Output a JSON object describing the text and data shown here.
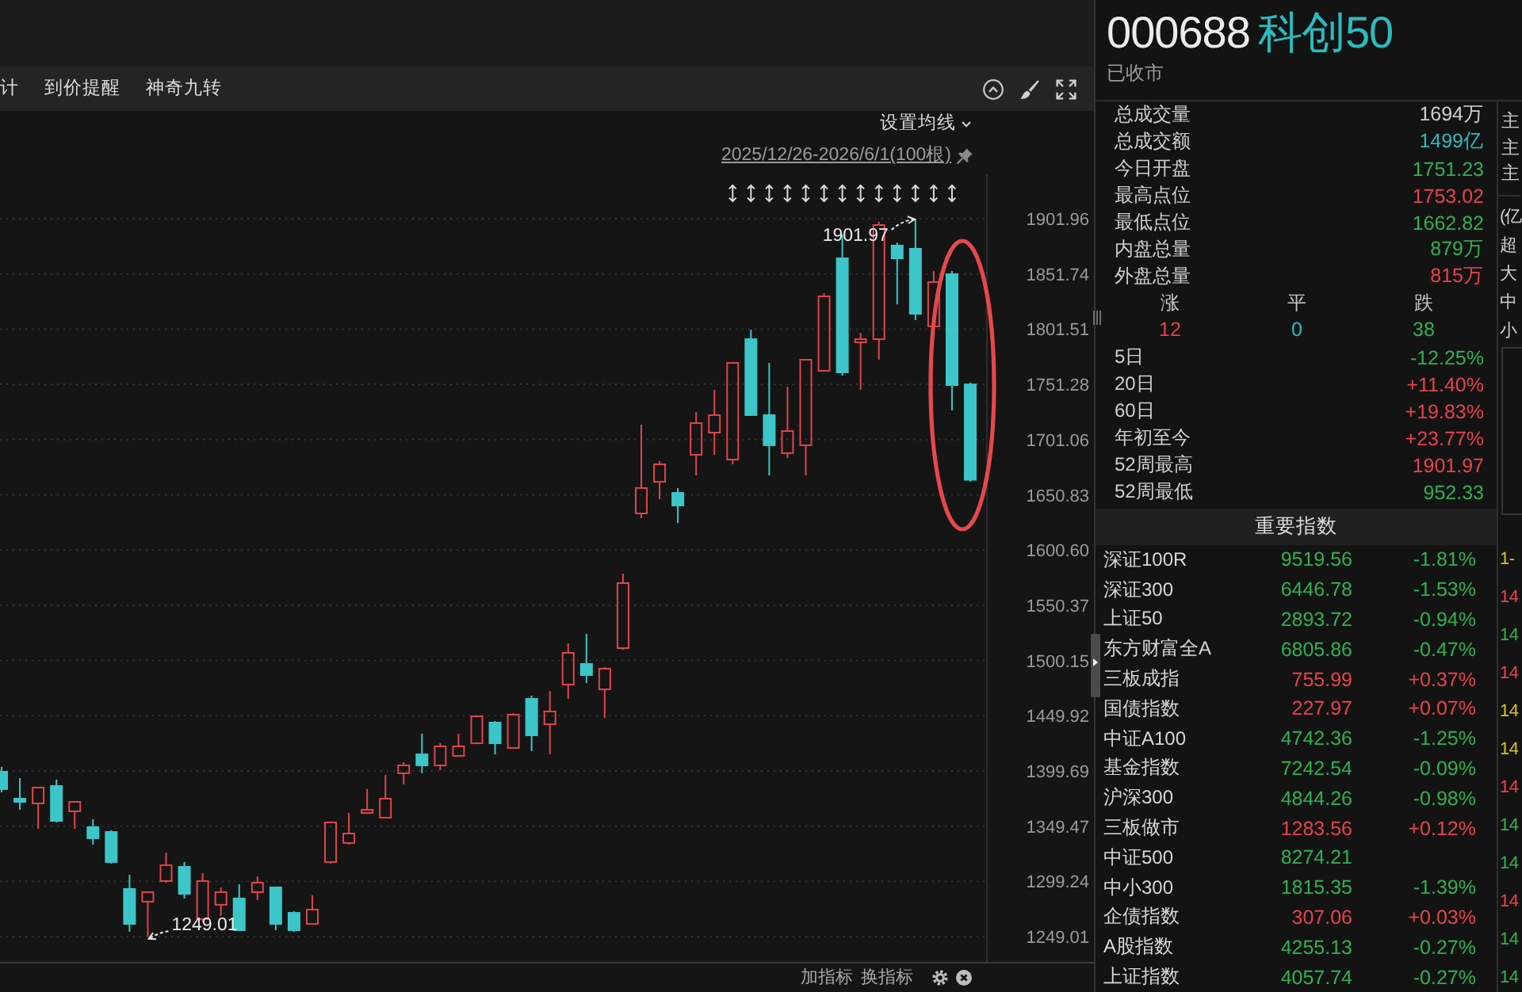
{
  "toolbar": {
    "items": [
      {
        "label": "计"
      },
      {
        "label": "到价提醒"
      },
      {
        "label": "神奇九转"
      }
    ]
  },
  "chart": {
    "ma_setting": "设置均线",
    "range": "2025/12/26-2026/6/1(100根)",
    "chart_data": {
      "type": "candlestick",
      "categories": [
        null,
        null,
        null,
        null,
        null,
        null,
        null,
        null,
        null,
        null,
        null,
        null,
        null,
        null,
        null,
        null,
        null,
        null,
        null,
        null,
        null,
        null,
        null,
        null,
        null,
        null,
        null,
        null,
        null,
        null,
        null,
        null,
        null,
        null,
        null,
        null,
        null,
        null,
        null,
        null,
        null,
        null,
        null,
        null,
        null,
        null,
        null,
        null,
        null,
        null,
        null,
        null,
        null,
        null
      ],
      "ohlc": [
        [
          1399.0,
          1403.3,
          1380.3,
          1383.2
        ],
        [
          1374.5,
          1393.2,
          1364.4,
          1371.6
        ],
        [
          1370.2,
          1384.6,
          1347.1,
          1384.6
        ],
        [
          1386.0,
          1391.8,
          1352.9,
          1354.3
        ],
        [
          1363.0,
          1371.6,
          1347.1,
          1371.6
        ],
        [
          1348.6,
          1355.8,
          1332.7,
          1338.5
        ],
        [
          1344.2,
          1345.7,
          1315.4,
          1316.9
        ],
        [
          1292.4,
          1305.3,
          1253.4,
          1260.6
        ],
        [
          1280.8,
          1289.5,
          1249.01,
          1289.5
        ],
        [
          1299.6,
          1325.5,
          1298.1,
          1314.0
        ],
        [
          1312.5,
          1316.9,
          1283.7,
          1288.0
        ],
        [
          1265.0,
          1306.8,
          1262.1,
          1299.6
        ],
        [
          1278.0,
          1293.8,
          1267.9,
          1289.5
        ],
        [
          1283.7,
          1296.7,
          1254.9,
          1254.9
        ],
        [
          1289.5,
          1303.9,
          1282.3,
          1298.1
        ],
        [
          1293.8,
          1293.8,
          1254.9,
          1260.6
        ],
        [
          1270.7,
          1272.2,
          1253.4,
          1254.9
        ],
        [
          1260.6,
          1286.6,
          1260.6,
          1273.6
        ],
        [
          1316.9,
          1352.9,
          1315.4,
          1352.9
        ],
        [
          1334.2,
          1361.5,
          1332.7,
          1342.8
        ],
        [
          1361.5,
          1383.2,
          1361.5,
          1364.4
        ],
        [
          1357.2,
          1396.1,
          1357.2,
          1374.5
        ],
        [
          1397.6,
          1407.6,
          1387.5,
          1404.8
        ],
        [
          1414.8,
          1433.6,
          1397.6,
          1404.8
        ],
        [
          1404.8,
          1424.9,
          1400.4,
          1422.1
        ],
        [
          1413.4,
          1433.6,
          1413.4,
          1422.1
        ],
        [
          1424.9,
          1449.4,
          1424.9,
          1449.4
        ],
        [
          1443.7,
          1445.1,
          1414.8,
          1424.9
        ],
        [
          1420.6,
          1452.3,
          1420.6,
          1450.9
        ],
        [
          1465.3,
          1468.2,
          1417.7,
          1432.1
        ],
        [
          1442.2,
          1472.5,
          1414.8,
          1453.8
        ],
        [
          1478.3,
          1515.7,
          1465.3,
          1507.1
        ],
        [
          1497.0,
          1524.4,
          1479.7,
          1486.9
        ],
        [
          1473.9,
          1494.1,
          1448.0,
          1492.7
        ],
        [
          1511.4,
          1579.1,
          1510.0,
          1570.5
        ],
        [
          1633.9,
          1714.6,
          1629.6,
          1657.0
        ],
        [
          1662.7,
          1681.5,
          1646.9,
          1678.6
        ],
        [
          1652.6,
          1657.0,
          1625.3,
          1641.1
        ],
        [
          1687.2,
          1726.1,
          1668.5,
          1716.0
        ],
        [
          1707.4,
          1746.3,
          1687.2,
          1723.3
        ],
        [
          1682.9,
          1770.8,
          1678.6,
          1770.8
        ],
        [
          1792.4,
          1801.1,
          1723.3,
          1723.3
        ],
        [
          1723.3,
          1770.8,
          1668.5,
          1695.9
        ],
        [
          1688.7,
          1749.2,
          1684.3,
          1708.8
        ],
        [
          1695.9,
          1773.7,
          1668.5,
          1773.7
        ],
        [
          1763.6,
          1834.2,
          1763.6,
          1831.3
        ],
        [
          1865.9,
          1887.5,
          1759.3,
          1762.2
        ],
        [
          1789.5,
          1798.2,
          1746.3,
          1792.4
        ],
        [
          1792.4,
          1899.1,
          1773.7,
          1896.2
        ],
        [
          1877.5,
          1880.3,
          1824.1,
          1865.9
        ],
        [
          1874.6,
          1901.97,
          1809.7,
          1815.5
        ],
        [
          1804.0,
          1854.4,
          1804.0,
          1844.3
        ],
        [
          1851.5,
          1854.4,
          1727.6,
          1750.6
        ],
        [
          1751.23,
          1753.02,
          1662.82,
          1664.5
        ]
      ],
      "ylim": [
        1224.62,
        1942.31
      ],
      "yticks": [
        1901.96,
        1851.74,
        1801.51,
        1751.28,
        1701.06,
        1650.83,
        {
          "value": 1600.6,
          "label": "1600.60"
        },
        1550.37,
        1500.15,
        1449.92,
        1399.69,
        1349.47,
        1299.24,
        1249.01
      ],
      "grid": true,
      "annotations": [
        "1901.97",
        "1249.01"
      ]
    }
  },
  "indicator_bar": {
    "buttons": [
      {
        "label": "加指标"
      },
      {
        "label": "换指标"
      }
    ]
  },
  "quote": {
    "code": "000688",
    "name": "科创50",
    "status": "已收市",
    "stats": [
      {
        "label": "总成交量",
        "value": "1694万",
        "color": "#d0d0d0"
      },
      {
        "label": "总成交额",
        "value": "1499亿",
        "color": "#2bbcc0"
      },
      {
        "label": "今日开盘",
        "value": "1751.23",
        "color": "#2fb24f"
      },
      {
        "label": "最高点位",
        "value": "1753.02",
        "color": "#e8434b"
      },
      {
        "label": "最低点位",
        "value": "1662.82",
        "color": "#2fb24f"
      },
      {
        "label": "内盘总量",
        "value": "879万",
        "color": "#2fb24f"
      },
      {
        "label": "外盘总量",
        "value": "815万",
        "color": "#e8434b"
      }
    ],
    "breadth": [
      {
        "label": "涨",
        "value": "12",
        "color": "#e8434b"
      },
      {
        "label": "平",
        "value": "0",
        "color": "#2bbcc0"
      },
      {
        "label": "跌",
        "value": "38",
        "color": "#2fb24f"
      }
    ],
    "changes": [
      {
        "label": "5日",
        "value": "-12.25%",
        "color": "#2fb24f"
      },
      {
        "label": "20日",
        "value": "+11.40%",
        "color": "#e8434b"
      },
      {
        "label": "60日",
        "value": "+19.83%",
        "color": "#e8434b"
      },
      {
        "label": "年初至今",
        "value": "+23.77%",
        "color": "#e8434b"
      },
      {
        "label": "52周最高",
        "value": "1901.97",
        "color": "#e8434b"
      },
      {
        "label": "52周最低",
        "value": "952.33",
        "color": "#2fb24f"
      }
    ]
  },
  "indices": {
    "title": "重要指数",
    "rows": [
      {
        "name": "深证100R",
        "value": "9519.56",
        "change": "-1.81%",
        "color": "#2fb24f"
      },
      {
        "name": "深证300",
        "value": "6446.78",
        "change": "-1.53%",
        "color": "#2fb24f"
      },
      {
        "name": "上证50",
        "value": "2893.72",
        "change": "-0.94%",
        "color": "#2fb24f"
      },
      {
        "name": "东方财富全A",
        "value": "6805.86",
        "change": "-0.47%",
        "color": "#2fb24f"
      },
      {
        "name": "三板成指",
        "value": "755.99",
        "change": "+0.37%",
        "color": "#e8434b"
      },
      {
        "name": "国债指数",
        "value": "227.97",
        "change": "+0.07%",
        "color": "#e8434b"
      },
      {
        "name": "中证A100",
        "value": "4742.36",
        "change": "-1.25%",
        "color": "#2fb24f"
      },
      {
        "name": "基金指数",
        "value": "7242.54",
        "change": "-0.09%",
        "color": "#2fb24f"
      },
      {
        "name": "沪深300",
        "value": "4844.26",
        "change": "-0.98%",
        "color": "#2fb24f"
      },
      {
        "name": "三板做市",
        "value": "1283.56",
        "change": "+0.12%",
        "color": "#e8434b"
      },
      {
        "name": "中证500",
        "value": "8274.21",
        "color": "#2fb24f"
      },
      {
        "name": "中小300",
        "value": "1815.35",
        "change": "-1.39%",
        "color": "#2fb24f"
      },
      {
        "name": "企债指数",
        "value": "307.06",
        "change": "+0.03%",
        "color": "#e8434b"
      },
      {
        "name": "A股指数",
        "value": "4255.13",
        "change": "-0.27%",
        "color": "#2fb24f"
      },
      {
        "name": "上证指数",
        "value": "4057.74",
        "change": "-0.27%",
        "color": "#2fb24f"
      }
    ]
  },
  "side_panel": {
    "top_labels": [
      "主",
      "主",
      "主"
    ],
    "flow_labels": [
      "(亿",
      "超",
      "大",
      "中",
      "小"
    ],
    "values": [
      {
        "text": "1-",
        "color": "#d2c32a"
      },
      {
        "text": "14",
        "color": "#e8434b"
      },
      {
        "text": "14",
        "color": "#2fb24f"
      },
      {
        "text": "14",
        "color": "#e8434b"
      },
      {
        "text": "14",
        "color": "#d2c32a"
      },
      {
        "text": "14",
        "color": "#d2c32a"
      },
      {
        "text": "14",
        "color": "#e8434b"
      },
      {
        "text": "14",
        "color": "#2fb24f"
      },
      {
        "text": "14",
        "color": "#2fb24f"
      },
      {
        "text": "14",
        "color": "#e8434b"
      },
      {
        "text": "14",
        "color": "#2fb24f"
      },
      {
        "text": "14",
        "color": "#2fb24f"
      }
    ]
  }
}
